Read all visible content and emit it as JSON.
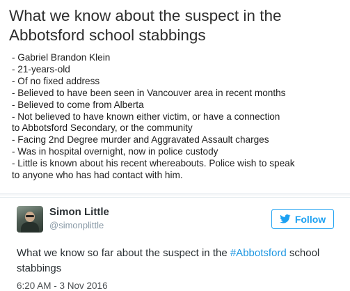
{
  "image_card": {
    "headline": "What we know about the suspect in the Abbotsford school stabbings",
    "facts": [
      "- Gabriel Brandon Klein",
      "- 21-years-old",
      "- Of no fixed address",
      "- Believed to have been seen in Vancouver area in recent months",
      "- Believed to come from Alberta",
      "- Not believed to have known either victim, or have a connection",
      "to Abbotsford Secondary, or the community",
      "- Facing 2nd Degree murder and Aggravated Assault charges",
      "- Was in hospital overnight, now in police custody",
      "- Little is known about his recent whereabouts. Police wish to speak",
      "to anyone who has had contact with him."
    ]
  },
  "tweet": {
    "display_name": "Simon Little",
    "handle": "@simonplittle",
    "follow_label": "Follow",
    "text_before": "What we know so far about the suspect in the ",
    "hashtag": "#Abbotsford",
    "text_after": " school stabbings",
    "timestamp": "6:20 AM - 3 Nov 2016",
    "icons": {
      "follow": "twitter-bird-icon"
    },
    "colors": {
      "accent": "#1da1f2",
      "hashtag": "#1b95e0",
      "handle": "#8899a6"
    }
  }
}
